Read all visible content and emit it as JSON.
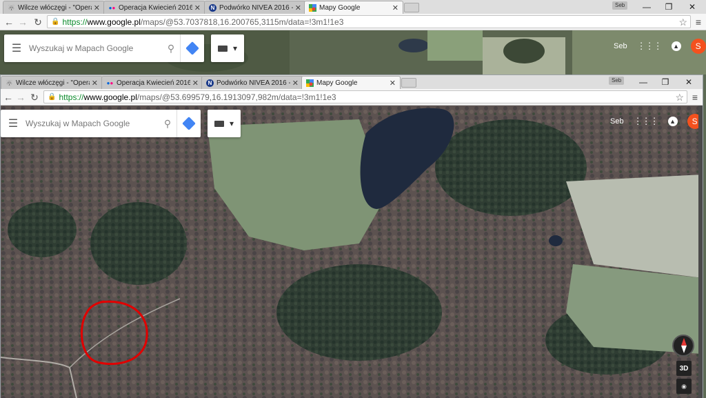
{
  "outer": {
    "tabs": [
      {
        "icon": "wolf-favicon-icon",
        "label": "Wilcze włóczęgi - \"Opera"
      },
      {
        "icon": "flickr-favicon-icon",
        "label": "Operacja Kwiecień 2016 |"
      },
      {
        "icon": "nivea-favicon-icon",
        "label": "Podwórko NIVEA 2016 - N"
      },
      {
        "icon": "google-maps-favicon-icon",
        "label": "Mapy Google"
      }
    ],
    "profile": "Seb",
    "url_scheme": "https://",
    "url_domain": "www.google.pl",
    "url_path": "/maps/@53.7037818,16.200765,3115m/data=!3m1!1e3",
    "search_placeholder": "Wyszukaj w Mapach Google",
    "user_name": "Seb",
    "avatar_letter": "S"
  },
  "inner": {
    "tabs": [
      {
        "icon": "wolf-favicon-icon",
        "label": "Wilcze włóczęgi - \"Opera"
      },
      {
        "icon": "flickr-favicon-icon",
        "label": "Operacja Kwiecień 2016 |"
      },
      {
        "icon": "nivea-favicon-icon",
        "label": "Podwórko NIVEA 2016 - N"
      },
      {
        "icon": "google-maps-favicon-icon",
        "label": "Mapy Google"
      }
    ],
    "profile": "Seb",
    "url_scheme": "https://",
    "url_domain": "www.google.pl",
    "url_path": "/maps/@53.699579,16.1913097,982m/data=!3m1!1e3",
    "search_placeholder": "Wyszukaj w Mapach Google",
    "user_name": "Seb",
    "avatar_letter": "S",
    "btn_3d": "3D"
  },
  "colors": {
    "avatar": "#f4511e",
    "directions": "#4285f4",
    "annotation_circle": "#e00000"
  }
}
